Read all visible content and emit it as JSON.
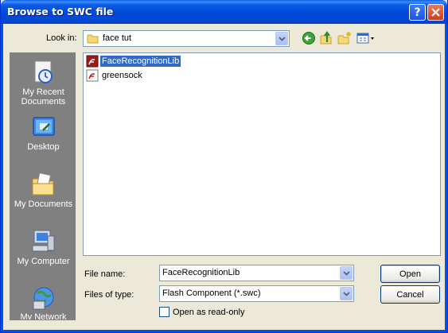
{
  "window": {
    "title": "Browse to SWC file"
  },
  "colors": {
    "titlebar": "#0054e3",
    "selection": "#316ac5",
    "places_bg": "#808080",
    "window_bg": "#ece9d8"
  },
  "lookin": {
    "label": "Look in:",
    "value": "face tut"
  },
  "toolbar": {
    "icons": [
      "back-icon",
      "up-folder-icon",
      "new-folder-icon",
      "view-menu-icon"
    ]
  },
  "places": [
    {
      "label": "My Recent Documents",
      "icon": "recent-documents-icon"
    },
    {
      "label": "Desktop",
      "icon": "desktop-icon"
    },
    {
      "label": "My Documents",
      "icon": "my-documents-icon"
    },
    {
      "label": "My Computer",
      "icon": "my-computer-icon"
    },
    {
      "label": "My Network Places",
      "icon": "network-places-icon"
    }
  ],
  "files": [
    {
      "name": "FaceRecognitionLib",
      "icon": "flash-swc-icon",
      "selected": true
    },
    {
      "name": "greensock",
      "icon": "flash-swc-icon",
      "selected": false
    }
  ],
  "filename": {
    "label": "File name:",
    "value": "FaceRecognitionLib"
  },
  "filetype": {
    "label": "Files of type:",
    "value": "Flash Component (*.swc)"
  },
  "readonly": {
    "label": "Open as read-only",
    "checked": false
  },
  "buttons": {
    "open": "Open",
    "cancel": "Cancel"
  }
}
